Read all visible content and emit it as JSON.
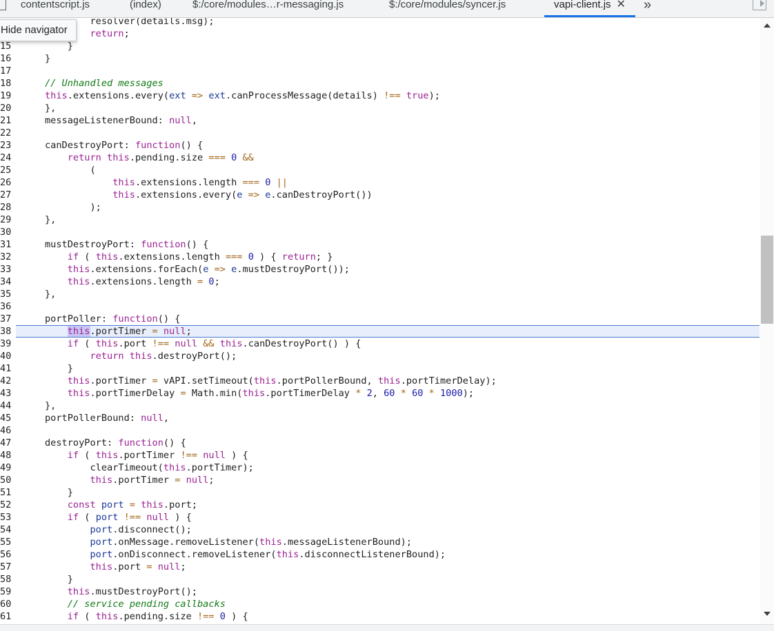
{
  "tabs": [
    {
      "label": "contentscript.js",
      "active": false
    },
    {
      "label": "(index)",
      "active": false
    },
    {
      "label": "$:/core/modules…r-messaging.js",
      "active": false
    },
    {
      "label": "$:/core/modules/syncer.js",
      "active": false
    },
    {
      "label": "vapi-client.js",
      "active": true
    }
  ],
  "tab_close_glyph": "✕",
  "more_tabs_glyph": "»",
  "tooltip": "Hide navigator",
  "accent_color": "#1a73e8",
  "lines": [
    {
      "n": "",
      "tokens": [
        [
          "        ",
          "plain"
        ],
        [
          "resolver(details.msg);",
          "plain"
        ]
      ]
    },
    {
      "n": "",
      "tokens": [
        [
          "        ",
          "plain"
        ],
        [
          "return",
          "kw"
        ],
        [
          ";",
          "plain"
        ]
      ]
    },
    {
      "n": "15",
      "tokens": [
        [
          "    }",
          "plain"
        ]
      ]
    },
    {
      "n": "16",
      "tokens": [
        [
          "}",
          "plain"
        ]
      ]
    },
    {
      "n": "17",
      "tokens": [
        [
          "",
          "plain"
        ]
      ]
    },
    {
      "n": "18",
      "tokens": [
        [
          "// Unhandled messages",
          "cm"
        ]
      ]
    },
    {
      "n": "19",
      "tokens": [
        [
          "this",
          "kw"
        ],
        [
          ".extensions.every(",
          "plain"
        ],
        [
          "ext",
          "var"
        ],
        [
          " ",
          "plain"
        ],
        [
          "=>",
          "op"
        ],
        [
          " ",
          "plain"
        ],
        [
          "ext",
          "var"
        ],
        [
          ".canProcessMessage(details) ",
          "plain"
        ],
        [
          "!==",
          "op"
        ],
        [
          " ",
          "plain"
        ],
        [
          "true",
          "lit"
        ],
        [
          ");",
          "plain"
        ]
      ]
    },
    {
      "n": "20",
      "tokens": [
        [
          "},",
          "plain"
        ]
      ]
    },
    {
      "n": "21",
      "tokens": [
        [
          "messageListenerBound: ",
          "plain"
        ],
        [
          "null",
          "lit"
        ],
        [
          ",",
          "plain"
        ]
      ]
    },
    {
      "n": "22",
      "tokens": [
        [
          "",
          "plain"
        ]
      ]
    },
    {
      "n": "23",
      "tokens": [
        [
          "canDestroyPort: ",
          "plain"
        ],
        [
          "function",
          "kw"
        ],
        [
          "() {",
          "plain"
        ]
      ]
    },
    {
      "n": "24",
      "tokens": [
        [
          "    ",
          "plain"
        ],
        [
          "return",
          "kw"
        ],
        [
          " ",
          "plain"
        ],
        [
          "this",
          "kw"
        ],
        [
          ".pending.size ",
          "plain"
        ],
        [
          "===",
          "op"
        ],
        [
          " ",
          "plain"
        ],
        [
          "0",
          "num"
        ],
        [
          " ",
          "plain"
        ],
        [
          "&&",
          "op"
        ]
      ]
    },
    {
      "n": "25",
      "tokens": [
        [
          "        (",
          "plain"
        ]
      ]
    },
    {
      "n": "26",
      "tokens": [
        [
          "            ",
          "plain"
        ],
        [
          "this",
          "kw"
        ],
        [
          ".extensions.length ",
          "plain"
        ],
        [
          "===",
          "op"
        ],
        [
          " ",
          "plain"
        ],
        [
          "0",
          "num"
        ],
        [
          " ",
          "plain"
        ],
        [
          "||",
          "op"
        ]
      ]
    },
    {
      "n": "27",
      "tokens": [
        [
          "            ",
          "plain"
        ],
        [
          "this",
          "kw"
        ],
        [
          ".extensions.every(",
          "plain"
        ],
        [
          "e",
          "var"
        ],
        [
          " ",
          "plain"
        ],
        [
          "=>",
          "op"
        ],
        [
          " ",
          "plain"
        ],
        [
          "e",
          "var"
        ],
        [
          ".canDestroyPort())",
          "plain"
        ]
      ]
    },
    {
      "n": "28",
      "tokens": [
        [
          "        );",
          "plain"
        ]
      ]
    },
    {
      "n": "29",
      "tokens": [
        [
          "},",
          "plain"
        ]
      ]
    },
    {
      "n": "30",
      "tokens": [
        [
          "",
          "plain"
        ]
      ]
    },
    {
      "n": "31",
      "tokens": [
        [
          "mustDestroyPort: ",
          "plain"
        ],
        [
          "function",
          "kw"
        ],
        [
          "() {",
          "plain"
        ]
      ]
    },
    {
      "n": "32",
      "tokens": [
        [
          "    ",
          "plain"
        ],
        [
          "if",
          "kw"
        ],
        [
          " ( ",
          "plain"
        ],
        [
          "this",
          "kw"
        ],
        [
          ".extensions.length ",
          "plain"
        ],
        [
          "===",
          "op"
        ],
        [
          " ",
          "plain"
        ],
        [
          "0",
          "num"
        ],
        [
          " ) { ",
          "plain"
        ],
        [
          "return",
          "kw"
        ],
        [
          "; }",
          "plain"
        ]
      ]
    },
    {
      "n": "33",
      "tokens": [
        [
          "    ",
          "plain"
        ],
        [
          "this",
          "kw"
        ],
        [
          ".extensions.forEach(",
          "plain"
        ],
        [
          "e",
          "var"
        ],
        [
          " ",
          "plain"
        ],
        [
          "=>",
          "op"
        ],
        [
          " ",
          "plain"
        ],
        [
          "e",
          "var"
        ],
        [
          ".mustDestroyPort());",
          "plain"
        ]
      ]
    },
    {
      "n": "34",
      "tokens": [
        [
          "    ",
          "plain"
        ],
        [
          "this",
          "kw"
        ],
        [
          ".extensions.length ",
          "plain"
        ],
        [
          "=",
          "op"
        ],
        [
          " ",
          "plain"
        ],
        [
          "0",
          "num"
        ],
        [
          ";",
          "plain"
        ]
      ]
    },
    {
      "n": "35",
      "tokens": [
        [
          "},",
          "plain"
        ]
      ]
    },
    {
      "n": "36",
      "tokens": [
        [
          "",
          "plain"
        ]
      ]
    },
    {
      "n": "37",
      "tokens": [
        [
          "portPoller: ",
          "plain"
        ],
        [
          "function",
          "kw"
        ],
        [
          "() {",
          "plain"
        ]
      ]
    },
    {
      "n": "38",
      "current": true,
      "tokens": [
        [
          "    ",
          "plain"
        ],
        [
          "this",
          "kw-hl"
        ],
        [
          ".portTimer ",
          "plain"
        ],
        [
          "=",
          "op"
        ],
        [
          " ",
          "plain"
        ],
        [
          "null",
          "lit"
        ],
        [
          ";",
          "plain"
        ]
      ]
    },
    {
      "n": "39",
      "tokens": [
        [
          "    ",
          "plain"
        ],
        [
          "if",
          "kw"
        ],
        [
          " ( ",
          "plain"
        ],
        [
          "this",
          "kw"
        ],
        [
          ".port ",
          "plain"
        ],
        [
          "!==",
          "op"
        ],
        [
          " ",
          "plain"
        ],
        [
          "null",
          "lit"
        ],
        [
          " ",
          "plain"
        ],
        [
          "&&",
          "op"
        ],
        [
          " ",
          "plain"
        ],
        [
          "this",
          "kw"
        ],
        [
          ".canDestroyPort() ) {",
          "plain"
        ]
      ]
    },
    {
      "n": "40",
      "tokens": [
        [
          "        ",
          "plain"
        ],
        [
          "return",
          "kw"
        ],
        [
          " ",
          "plain"
        ],
        [
          "this",
          "kw"
        ],
        [
          ".destroyPort();",
          "plain"
        ]
      ]
    },
    {
      "n": "41",
      "tokens": [
        [
          "    }",
          "plain"
        ]
      ]
    },
    {
      "n": "42",
      "tokens": [
        [
          "    ",
          "plain"
        ],
        [
          "this",
          "kw"
        ],
        [
          ".portTimer ",
          "plain"
        ],
        [
          "=",
          "op"
        ],
        [
          " vAPI.setTimeout(",
          "plain"
        ],
        [
          "this",
          "kw"
        ],
        [
          ".portPollerBound, ",
          "plain"
        ],
        [
          "this",
          "kw"
        ],
        [
          ".portTimerDelay);",
          "plain"
        ]
      ]
    },
    {
      "n": "43",
      "tokens": [
        [
          "    ",
          "plain"
        ],
        [
          "this",
          "kw"
        ],
        [
          ".portTimerDelay ",
          "plain"
        ],
        [
          "=",
          "op"
        ],
        [
          " Math.min(",
          "plain"
        ],
        [
          "this",
          "kw"
        ],
        [
          ".portTimerDelay ",
          "plain"
        ],
        [
          "*",
          "op"
        ],
        [
          " ",
          "plain"
        ],
        [
          "2",
          "num"
        ],
        [
          ", ",
          "plain"
        ],
        [
          "60",
          "num"
        ],
        [
          " ",
          "plain"
        ],
        [
          "*",
          "op"
        ],
        [
          " ",
          "plain"
        ],
        [
          "60",
          "num"
        ],
        [
          " ",
          "plain"
        ],
        [
          "*",
          "op"
        ],
        [
          " ",
          "plain"
        ],
        [
          "1000",
          "num"
        ],
        [
          ");",
          "plain"
        ]
      ]
    },
    {
      "n": "44",
      "tokens": [
        [
          "},",
          "plain"
        ]
      ]
    },
    {
      "n": "45",
      "tokens": [
        [
          "portPollerBound: ",
          "plain"
        ],
        [
          "null",
          "lit"
        ],
        [
          ",",
          "plain"
        ]
      ]
    },
    {
      "n": "46",
      "tokens": [
        [
          "",
          "plain"
        ]
      ]
    },
    {
      "n": "47",
      "tokens": [
        [
          "destroyPort: ",
          "plain"
        ],
        [
          "function",
          "kw"
        ],
        [
          "() {",
          "plain"
        ]
      ]
    },
    {
      "n": "48",
      "tokens": [
        [
          "    ",
          "plain"
        ],
        [
          "if",
          "kw"
        ],
        [
          " ( ",
          "plain"
        ],
        [
          "this",
          "kw"
        ],
        [
          ".portTimer ",
          "plain"
        ],
        [
          "!==",
          "op"
        ],
        [
          " ",
          "plain"
        ],
        [
          "null",
          "lit"
        ],
        [
          " ) {",
          "plain"
        ]
      ]
    },
    {
      "n": "49",
      "tokens": [
        [
          "        clearTimeout(",
          "plain"
        ],
        [
          "this",
          "kw"
        ],
        [
          ".portTimer);",
          "plain"
        ]
      ]
    },
    {
      "n": "50",
      "tokens": [
        [
          "        ",
          "plain"
        ],
        [
          "this",
          "kw"
        ],
        [
          ".portTimer ",
          "plain"
        ],
        [
          "=",
          "op"
        ],
        [
          " ",
          "plain"
        ],
        [
          "null",
          "lit"
        ],
        [
          ";",
          "plain"
        ]
      ]
    },
    {
      "n": "51",
      "tokens": [
        [
          "    }",
          "plain"
        ]
      ]
    },
    {
      "n": "52",
      "tokens": [
        [
          "    ",
          "plain"
        ],
        [
          "const",
          "kw"
        ],
        [
          " ",
          "plain"
        ],
        [
          "port",
          "var"
        ],
        [
          " ",
          "plain"
        ],
        [
          "=",
          "op"
        ],
        [
          " ",
          "plain"
        ],
        [
          "this",
          "kw"
        ],
        [
          ".port;",
          "plain"
        ]
      ]
    },
    {
      "n": "53",
      "tokens": [
        [
          "    ",
          "plain"
        ],
        [
          "if",
          "kw"
        ],
        [
          " ( ",
          "plain"
        ],
        [
          "port",
          "var"
        ],
        [
          " ",
          "plain"
        ],
        [
          "!==",
          "op"
        ],
        [
          " ",
          "plain"
        ],
        [
          "null",
          "lit"
        ],
        [
          " ) {",
          "plain"
        ]
      ]
    },
    {
      "n": "54",
      "tokens": [
        [
          "        ",
          "plain"
        ],
        [
          "port",
          "var"
        ],
        [
          ".disconnect();",
          "plain"
        ]
      ]
    },
    {
      "n": "55",
      "tokens": [
        [
          "        ",
          "plain"
        ],
        [
          "port",
          "var"
        ],
        [
          ".onMessage.removeListener(",
          "plain"
        ],
        [
          "this",
          "kw"
        ],
        [
          ".messageListenerBound);",
          "plain"
        ]
      ]
    },
    {
      "n": "56",
      "tokens": [
        [
          "        ",
          "plain"
        ],
        [
          "port",
          "var"
        ],
        [
          ".onDisconnect.removeListener(",
          "plain"
        ],
        [
          "this",
          "kw"
        ],
        [
          ".disconnectListenerBound);",
          "plain"
        ]
      ]
    },
    {
      "n": "57",
      "tokens": [
        [
          "        ",
          "plain"
        ],
        [
          "this",
          "kw"
        ],
        [
          ".port ",
          "plain"
        ],
        [
          "=",
          "op"
        ],
        [
          " ",
          "plain"
        ],
        [
          "null",
          "lit"
        ],
        [
          ";",
          "plain"
        ]
      ]
    },
    {
      "n": "58",
      "tokens": [
        [
          "    }",
          "plain"
        ]
      ]
    },
    {
      "n": "59",
      "tokens": [
        [
          "    ",
          "plain"
        ],
        [
          "this",
          "kw"
        ],
        [
          ".mustDestroyPort();",
          "plain"
        ]
      ]
    },
    {
      "n": "60",
      "tokens": [
        [
          "    ",
          "plain"
        ],
        [
          "// service pending callbacks",
          "cm"
        ]
      ]
    },
    {
      "n": "61",
      "tokens": [
        [
          "    ",
          "plain"
        ],
        [
          "if",
          "kw"
        ],
        [
          " ( ",
          "plain"
        ],
        [
          "this",
          "kw"
        ],
        [
          ".pending.size ",
          "plain"
        ],
        [
          "!==",
          "op"
        ],
        [
          " ",
          "plain"
        ],
        [
          "0",
          "num"
        ],
        [
          " ) {",
          "plain"
        ]
      ]
    }
  ]
}
